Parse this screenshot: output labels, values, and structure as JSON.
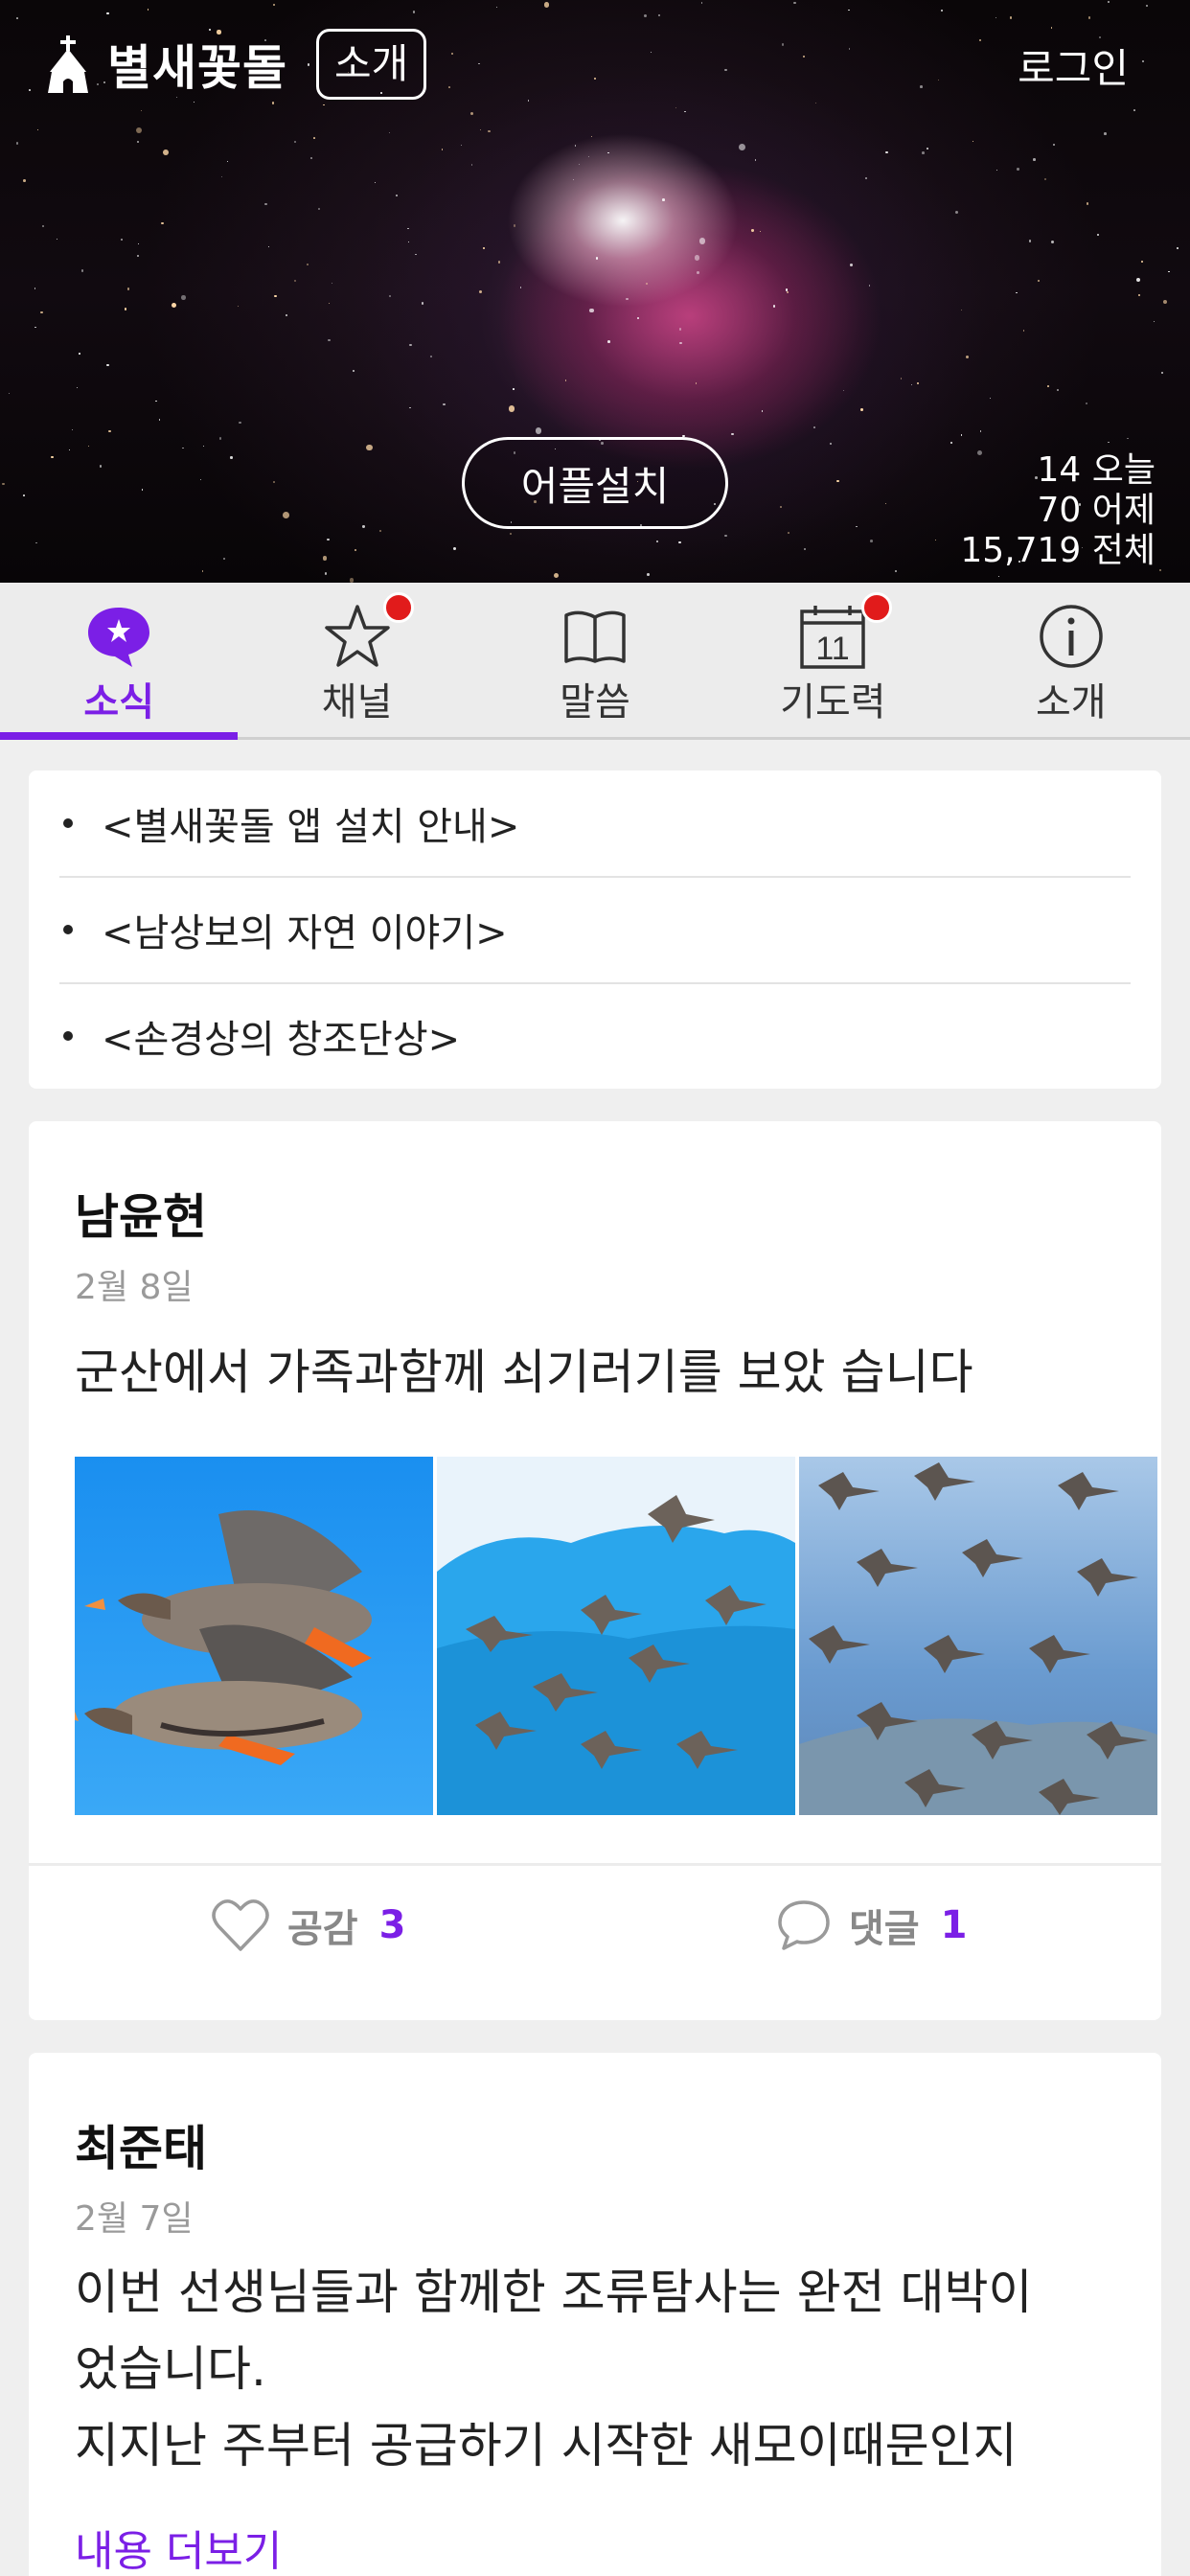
{
  "brand": {
    "name": "별새꽃돌",
    "intro_label": "소개"
  },
  "header": {
    "login_label": "로그인",
    "install_label": "어플설치"
  },
  "visitors": {
    "today": "14 오늘",
    "yesterday": "70 어제",
    "total": "15,719 전체"
  },
  "tabs": [
    {
      "label": "소식",
      "icon": "news-bubble-icon",
      "active": true
    },
    {
      "label": "채널",
      "icon": "star-icon",
      "badge": true
    },
    {
      "label": "말씀",
      "icon": "book-icon"
    },
    {
      "label": "기도력",
      "icon": "calendar-icon",
      "calendar_day": "11",
      "badge": true
    },
    {
      "label": "소개",
      "icon": "info-icon"
    }
  ],
  "notices": [
    "<별새꽃돌 앱 설치 안내>",
    "<남상보의 자연 이야기>",
    "<손경상의 창조단상>"
  ],
  "posts": [
    {
      "author": "남윤현",
      "date": "2월 8일",
      "text": "군산에서 가족과함께 쇠기러기를 보았 습니다",
      "photos": [
        "geese-closeup-photo",
        "geese-flock-mountain-photo",
        "geese-flock-sky-photo"
      ],
      "like_label": "공감",
      "like_count": "3",
      "comment_label": "댓글",
      "comment_count": "1"
    },
    {
      "author": "최준태",
      "date": "2월 7일",
      "text_lines": [
        "이번 선생님들과 함께한 조류탐사는 완전 대박이",
        "었습니다.",
        "지지난 주부터 공급하기 시작한 새모이때문인지"
      ],
      "more_label": "내용 더보기"
    }
  ],
  "colors": {
    "accent": "#7b1fe6",
    "badge": "#e11b1b"
  }
}
